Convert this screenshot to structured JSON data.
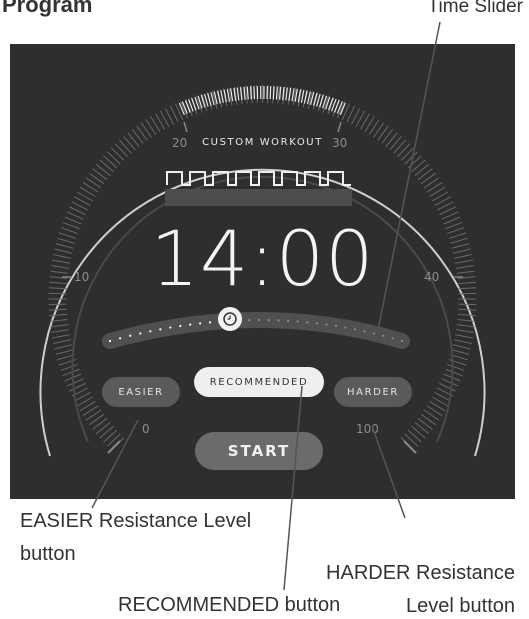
{
  "callouts": {
    "program": "Program",
    "time_slider": "Time Slider",
    "easier_line1": "EASIER Resistance Level",
    "easier_line2": "button",
    "harder_line1": "HARDER Resistance",
    "harder_line2": "Level button",
    "recommended": "RECOMMENDED button"
  },
  "dial": {
    "workout_title": "CUSTOM WORKOUT",
    "tick_20": "20",
    "tick_30": "30",
    "tick_10": "10",
    "tick_40": "40",
    "tick_0": "0",
    "tick_100": "100"
  },
  "timer": "14:00",
  "buttons": {
    "easier": "EASIER",
    "recommended": "RECOMMENDED",
    "harder": "HARDER",
    "start": "START"
  },
  "icons": {
    "slider_thumb": "clock-icon",
    "workout_profile": "square-wave-profile-icon"
  },
  "colors": {
    "screen_bg": "#2e2e2e",
    "button_dark": "#5a5a5a",
    "button_light": "#efefef"
  }
}
